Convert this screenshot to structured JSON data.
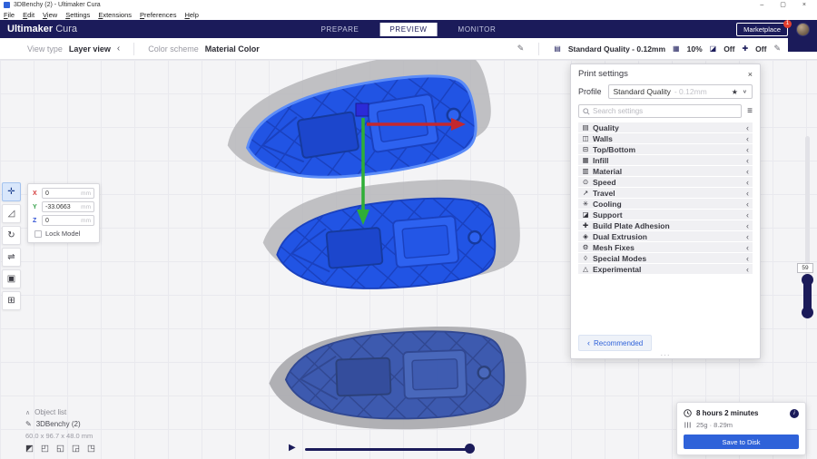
{
  "window": {
    "title": "3DBenchy (2) - Ultimaker Cura",
    "menu": [
      "File",
      "Edit",
      "View",
      "Settings",
      "Extensions",
      "Preferences",
      "Help"
    ],
    "controls": [
      {
        "name": "minimize",
        "glyph": "–"
      },
      {
        "name": "maximize",
        "glyph": "▢"
      },
      {
        "name": "close",
        "glyph": "×"
      }
    ]
  },
  "header": {
    "brand_bold": "Ultimaker",
    "brand_regular": "Cura",
    "tabs": [
      {
        "label": "PREPARE",
        "active": false
      },
      {
        "label": "PREVIEW",
        "active": true
      },
      {
        "label": "MONITOR",
        "active": false
      }
    ],
    "marketplace_label": "Marketplace",
    "marketplace_badge": "1"
  },
  "view_bar": {
    "view_type_label": "View type",
    "view_type_value": "Layer view",
    "color_scheme_label": "Color scheme",
    "color_scheme_value": "Material Color"
  },
  "setup_bar": {
    "profile_summary": "Standard Quality - 0.12mm",
    "infill_value": "10%",
    "support_value": "Off",
    "adhesion_value": "Off"
  },
  "print_settings": {
    "title": "Print settings",
    "profile_label": "Profile",
    "profile_value": "Standard Quality",
    "profile_suffix": "- 0.12mm",
    "search_placeholder": "Search settings",
    "categories": [
      {
        "name": "Quality",
        "icon": "quality-icon",
        "glyph": "▤"
      },
      {
        "name": "Walls",
        "icon": "walls-icon",
        "glyph": "◫"
      },
      {
        "name": "Top/Bottom",
        "icon": "top-bottom-icon",
        "glyph": "⊟"
      },
      {
        "name": "Infill",
        "icon": "infill-icon",
        "glyph": "▦"
      },
      {
        "name": "Material",
        "icon": "material-icon",
        "glyph": "▥"
      },
      {
        "name": "Speed",
        "icon": "speed-icon",
        "glyph": "⊙"
      },
      {
        "name": "Travel",
        "icon": "travel-icon",
        "glyph": "↗"
      },
      {
        "name": "Cooling",
        "icon": "cooling-icon",
        "glyph": "✳"
      },
      {
        "name": "Support",
        "icon": "support-icon",
        "glyph": "◪"
      },
      {
        "name": "Build Plate Adhesion",
        "icon": "adhesion-icon",
        "glyph": "✚"
      },
      {
        "name": "Dual Extrusion",
        "icon": "dual-extrusion-icon",
        "glyph": "◈"
      },
      {
        "name": "Mesh Fixes",
        "icon": "mesh-fixes-icon",
        "glyph": "⚙"
      },
      {
        "name": "Special Modes",
        "icon": "special-modes-icon",
        "glyph": "◊"
      },
      {
        "name": "Experimental",
        "icon": "experimental-icon",
        "glyph": "△"
      }
    ],
    "recommended_label": "Recommended"
  },
  "tools": [
    {
      "name": "move-tool",
      "glyph": "✛",
      "active": true
    },
    {
      "name": "scale-tool",
      "glyph": "◿",
      "active": false
    },
    {
      "name": "rotate-tool",
      "glyph": "↻",
      "active": false
    },
    {
      "name": "mirror-tool",
      "glyph": "⇌",
      "active": false
    },
    {
      "name": "per-model-settings-tool",
      "glyph": "▣",
      "active": false
    },
    {
      "name": "support-blocker-tool",
      "glyph": "⊞",
      "active": false
    }
  ],
  "position_panel": {
    "fields": [
      {
        "axis": "X",
        "value": "0",
        "unit": "mm",
        "color": "#d43a3a"
      },
      {
        "axis": "Y",
        "value": "-33.0663",
        "unit": "mm",
        "color": "#35a04a"
      },
      {
        "axis": "Z",
        "value": "0",
        "unit": "mm",
        "color": "#3353d4"
      }
    ],
    "lock_label": "Lock Model"
  },
  "object_panel": {
    "list_label": "Object list",
    "object_name": "3DBenchy (2)",
    "dimensions": "60.0 x 96.7 x 48.0 mm",
    "view_icons": [
      "3d-view-icon",
      "front-view-icon",
      "top-view-icon",
      "left-view-icon",
      "right-view-icon"
    ],
    "view_glyphs": [
      "◩",
      "◰",
      "◱",
      "◲",
      "◳"
    ]
  },
  "output_panel": {
    "time_estimate": "8 hours 2 minutes",
    "material_estimate": "25g · 8.29m",
    "save_button": "Save to Disk"
  },
  "layer_slider": {
    "current_layer": "59"
  },
  "icons": {
    "star": "★",
    "chevron_down": "∨",
    "chevron_left": "‹",
    "hamburger": "≡",
    "pencil": "✎",
    "play": "▶",
    "caret_up": "∧",
    "dots": "···",
    "profile": "▤",
    "infill": "▦",
    "support": "◪",
    "adhesion": "✚",
    "info": "i"
  },
  "colors": {
    "navy": "#1b1b5a",
    "accent_blue": "#2f62d9",
    "model_blue": "#2356e6",
    "selection_blue": "#5b8cf8",
    "shadow_gray": "#b6b6ba"
  }
}
